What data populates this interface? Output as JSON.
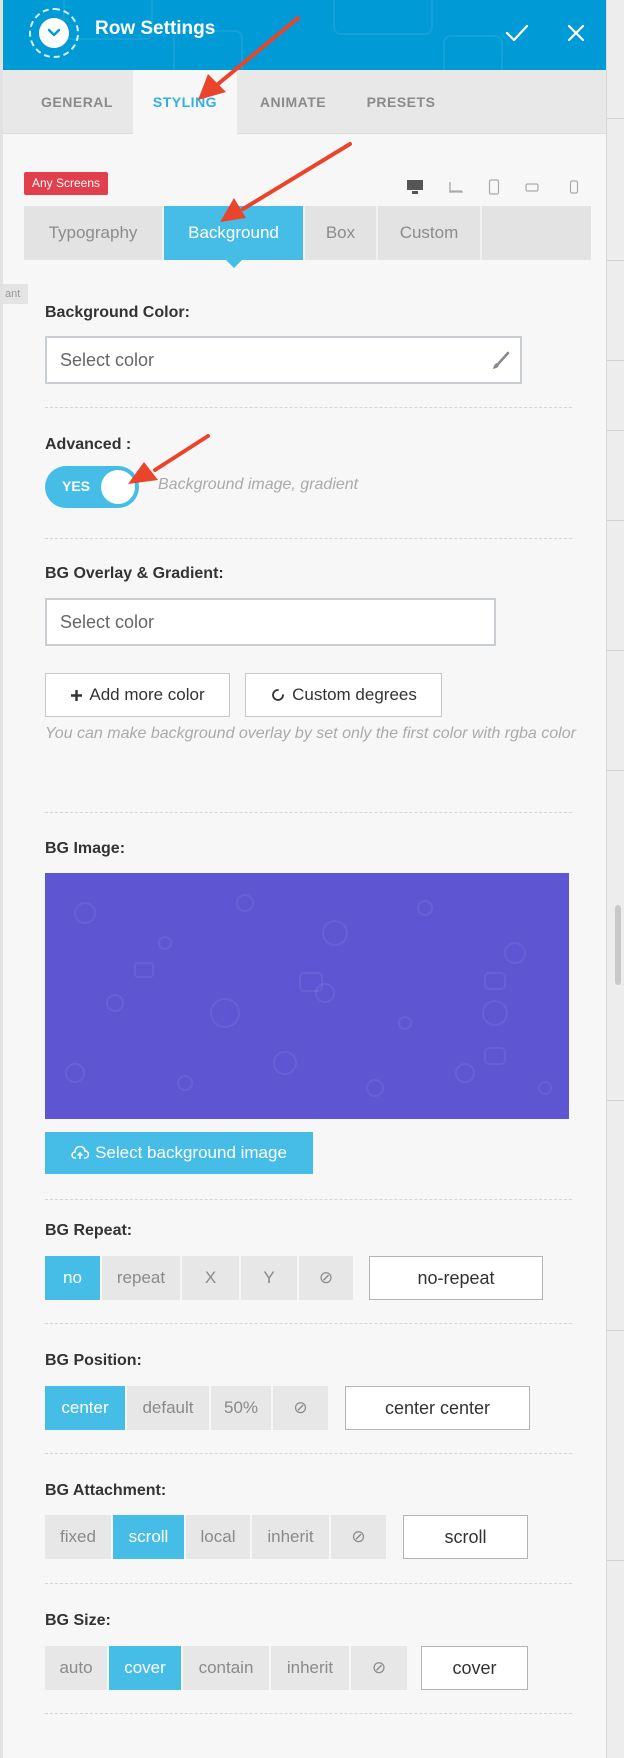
{
  "header": {
    "title": "Row Settings",
    "collapse_icon": "chevron-down-icon",
    "confirm_icon": "check-icon",
    "close_icon": "close-icon",
    "color": "#009ad7"
  },
  "main_tabs": [
    {
      "label": "GENERAL"
    },
    {
      "label": "STYLING"
    },
    {
      "label": "ANIMATE"
    },
    {
      "label": "PRESETS"
    }
  ],
  "screens": {
    "badge": "Any Screens",
    "devices": [
      "desktop-icon",
      "laptop-icon",
      "tablet-icon",
      "tablet-landscape-icon",
      "phone-icon"
    ]
  },
  "sub_tabs": [
    {
      "label": "Typography"
    },
    {
      "label": "Background"
    },
    {
      "label": "Box"
    },
    {
      "label": "Custom"
    }
  ],
  "side_tag": "ant",
  "background_color": {
    "label": "Background Color:",
    "placeholder": "Select color"
  },
  "advanced": {
    "label": "Advanced :",
    "toggle": "YES",
    "description": "Background image, gradient"
  },
  "overlay": {
    "label": "BG Overlay & Gradient:",
    "placeholder": "Select color",
    "add_more": "Add more color",
    "custom_degrees": "Custom degrees",
    "hint": "You can make background overlay by set only the first color with rgba color"
  },
  "bg_image": {
    "label": "BG Image:",
    "button": "Select background image",
    "swatch_color": "#5d55d2"
  },
  "bg_repeat": {
    "label": "BG Repeat:",
    "options": [
      "no",
      "repeat",
      "X",
      "Y",
      "⊘"
    ],
    "value": "no-repeat"
  },
  "bg_position": {
    "label": "BG Position:",
    "options": [
      "center",
      "default",
      "50%",
      "⊘"
    ],
    "value": "center center"
  },
  "bg_attachment": {
    "label": "BG Attachment:",
    "options": [
      "fixed",
      "scroll",
      "local",
      "inherit",
      "⊘"
    ],
    "value": "scroll"
  },
  "bg_size": {
    "label": "BG Size:",
    "options": [
      "auto",
      "cover",
      "contain",
      "inherit",
      "⊘"
    ],
    "value": "cover"
  },
  "colors": {
    "accent": "#46bde6",
    "badge": "#e03f4b",
    "annotation_arrow": "#e8452c"
  }
}
